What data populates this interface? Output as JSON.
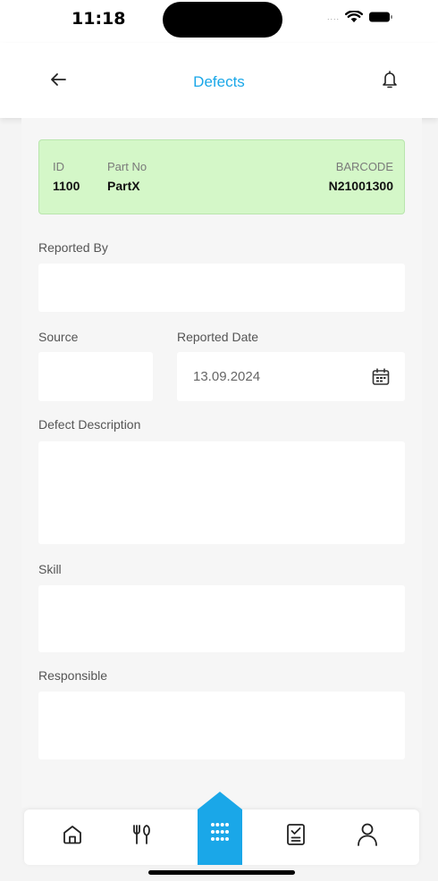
{
  "status_bar": {
    "time": "11:18",
    "signal": "....",
    "icons": [
      "wifi-icon",
      "battery-icon"
    ]
  },
  "header": {
    "title": "Defects",
    "back_icon": "arrow-left-icon",
    "bell_icon": "bell-icon"
  },
  "info_card": {
    "id_label": "ID",
    "id_value": "1100",
    "part_label": "Part No",
    "part_value": "PartX",
    "barcode_label": "BARCODE",
    "barcode_value": "N21001300"
  },
  "form": {
    "reported_by": {
      "label": "Reported By",
      "value": ""
    },
    "source": {
      "label": "Source",
      "value": ""
    },
    "reported_date": {
      "label": "Reported Date",
      "value": "13.09.2024",
      "icon": "calendar-icon"
    },
    "defect_description": {
      "label": "Defect Description",
      "value": ""
    },
    "skill": {
      "label": "Skill",
      "value": ""
    },
    "responsible": {
      "label": "Responsible",
      "value": ""
    }
  },
  "bottom_nav": {
    "items": [
      "home-icon",
      "restaurant-icon",
      "apps-grid-icon",
      "checklist-icon",
      "profile-icon"
    ],
    "active": "apps-grid-icon"
  },
  "colors": {
    "accent": "#1aa7e8",
    "card_bg": "#d4f7c8",
    "background": "#f6f6f6"
  }
}
